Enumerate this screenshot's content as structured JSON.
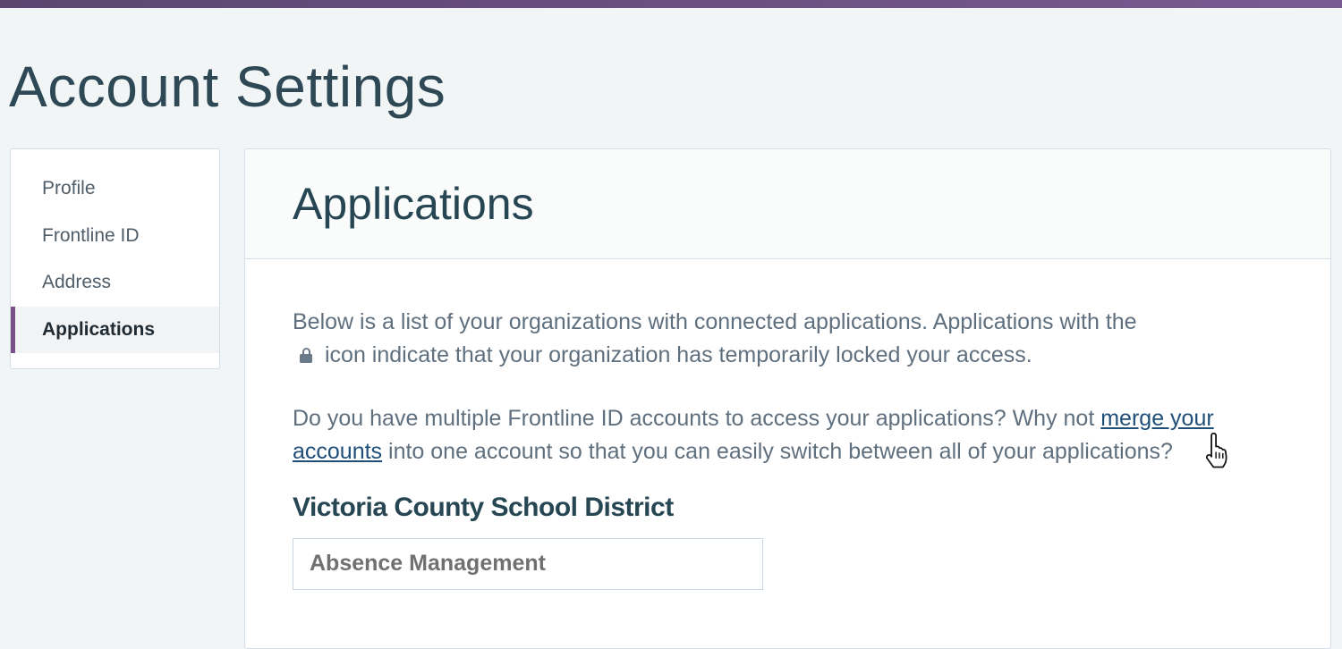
{
  "page": {
    "title": "Account Settings"
  },
  "sidebar": {
    "items": [
      {
        "label": "Profile",
        "active": false
      },
      {
        "label": "Frontline ID",
        "active": false
      },
      {
        "label": "Address",
        "active": false
      },
      {
        "label": "Applications",
        "active": true
      }
    ]
  },
  "panel": {
    "title": "Applications",
    "intro": {
      "text_before_icon": "Below is a list of your organizations with connected applications. Applications with the",
      "icon": "lock-icon",
      "text_after_icon": "icon indicate that your organization has temporarily locked your access."
    },
    "merge": {
      "text_before_link": "Do you have multiple Frontline ID accounts to access your applications? Why not",
      "link_label": "merge your accounts",
      "text_after_link": "into one account so that you can easily switch between all of your applications?"
    },
    "organizations": [
      {
        "name": "Victoria County School District",
        "applications": [
          "Absence Management"
        ]
      }
    ]
  },
  "colors": {
    "top_bar": "#6a4f80",
    "active_indicator": "#7a4f8a",
    "heading": "#264653",
    "link": "#1f4e79"
  },
  "cursor": {
    "icon": "hand-pointer-icon"
  }
}
